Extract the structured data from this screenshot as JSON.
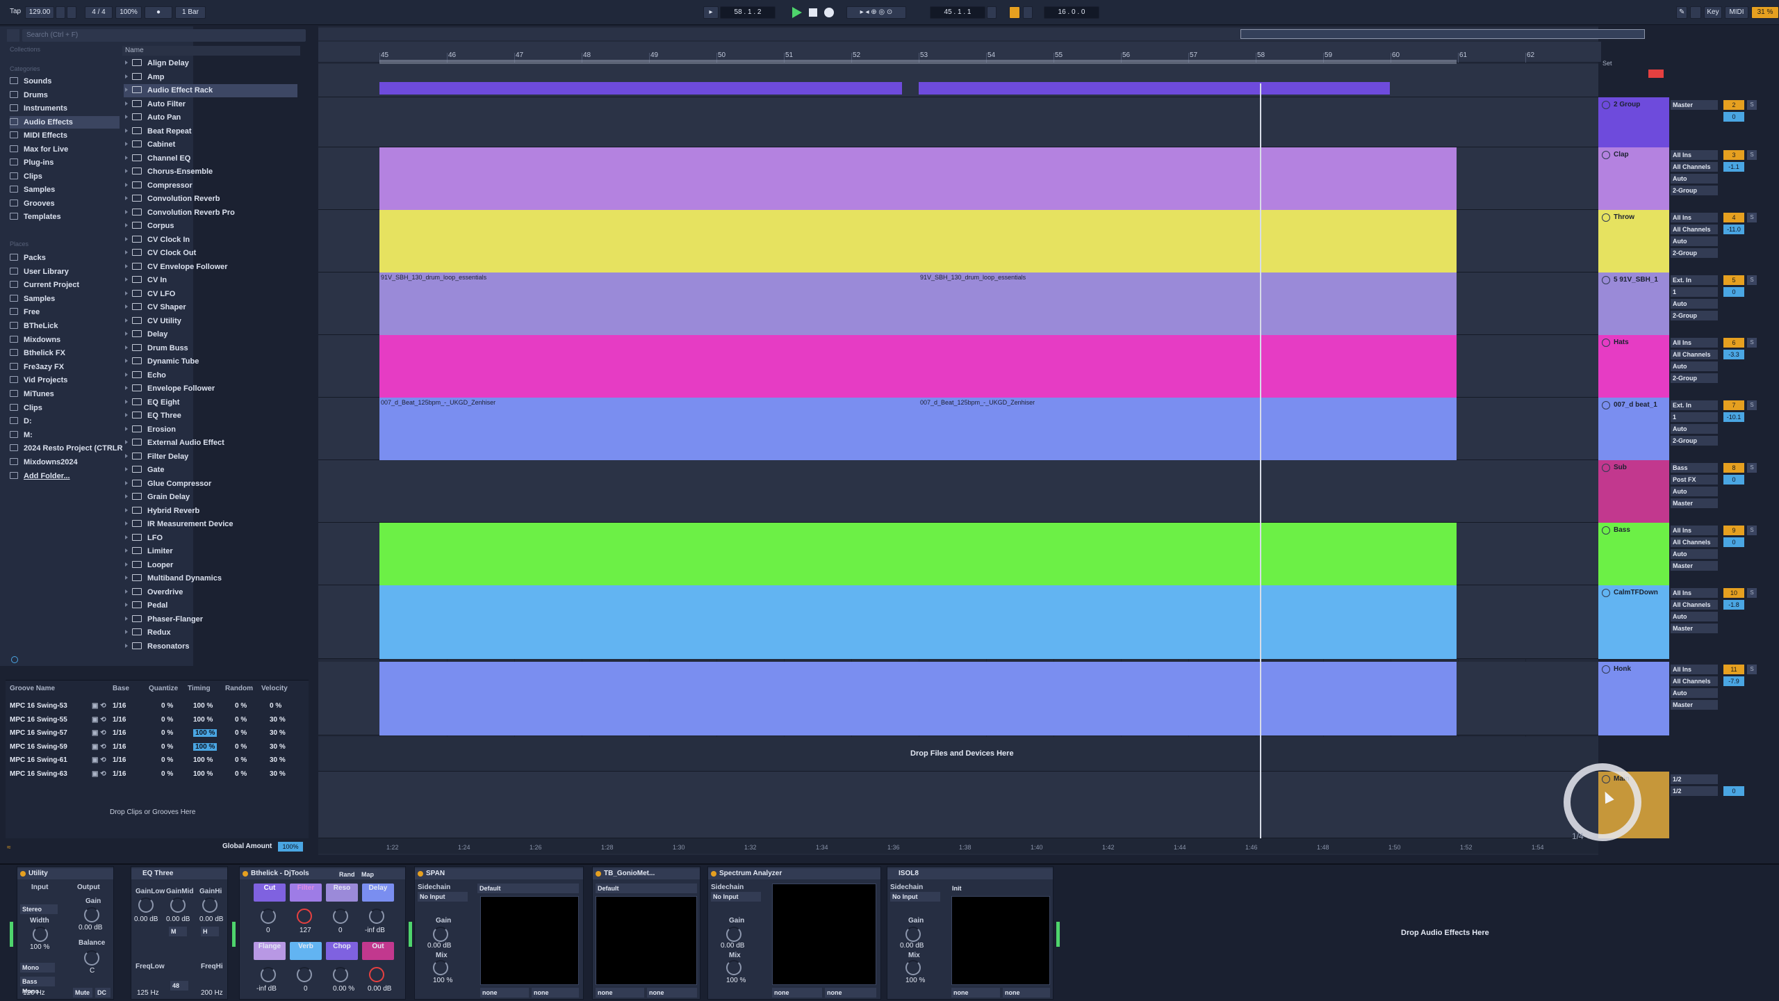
{
  "colors": {
    "accent": "#e6a020",
    "selection": "#4aa6e3",
    "play": "#4ed46c",
    "background": "#1b2131"
  },
  "transport": {
    "tap": "Tap",
    "tempo": "129.00",
    "time_sig": "4 / 4",
    "zoom": "100%",
    "quantize": "1 Bar",
    "position": "58 . 1 . 2",
    "loop_start": "45 . 1 . 1",
    "loop_length": "16 . 0 . 0",
    "key_label": "Key",
    "midi_label": "MIDI",
    "cpu": "31 %"
  },
  "browser": {
    "search_placeholder": "Search (Ctrl + F)",
    "collections_header": "Collections",
    "categories_header": "Categories",
    "places_header": "Places",
    "categories": [
      "Sounds",
      "Drums",
      "Instruments",
      "Audio Effects",
      "MIDI Effects",
      "Max for Live",
      "Plug-ins",
      "Clips",
      "Samples",
      "Grooves",
      "Templates"
    ],
    "places": [
      "Packs",
      "User Library",
      "Current Project",
      "Samples",
      "Free",
      "BTheLick",
      "Mixdowns",
      "Bthelick FX",
      "Fre3azy FX",
      "Vid Projects",
      "MiTunes",
      "Clips",
      "D:",
      "M:",
      "2024 Resto Project (CTRLR",
      "Mixdowns2024",
      "Add Folder..."
    ],
    "name_header": "Name",
    "items": [
      "Align Delay",
      "Amp",
      "Audio Effect Rack",
      "Auto Filter",
      "Auto Pan",
      "Beat Repeat",
      "Cabinet",
      "Channel EQ",
      "Chorus-Ensemble",
      "Compressor",
      "Convolution Reverb",
      "Convolution Reverb Pro",
      "Corpus",
      "CV Clock In",
      "CV Clock Out",
      "CV Envelope Follower",
      "CV In",
      "CV LFO",
      "CV Shaper",
      "CV Utility",
      "Delay",
      "Drum Buss",
      "Dynamic Tube",
      "Echo",
      "Envelope Follower",
      "EQ Eight",
      "EQ Three",
      "Erosion",
      "External Audio Effect",
      "Filter Delay",
      "Gate",
      "Glue Compressor",
      "Grain Delay",
      "Hybrid Reverb",
      "IR Measurement Device",
      "LFO",
      "Limiter",
      "Looper",
      "Multiband Dynamics",
      "Overdrive",
      "Pedal",
      "Phaser-Flanger",
      "Redux",
      "Resonators"
    ]
  },
  "groove_pool": {
    "headers": [
      "Groove Name",
      "Base",
      "Quantize",
      "Timing",
      "Random",
      "Velocity"
    ],
    "rows": [
      {
        "name": "MPC 16 Swing-53",
        "base": "1/16",
        "quantize": "0 %",
        "timing": "100 %",
        "random": "0 %",
        "velocity": "0 %"
      },
      {
        "name": "MPC 16 Swing-55",
        "base": "1/16",
        "quantize": "0 %",
        "timing": "100 %",
        "random": "0 %",
        "velocity": "30 %"
      },
      {
        "name": "MPC 16 Swing-57",
        "base": "1/16",
        "quantize": "0 %",
        "timing": "100 %",
        "random": "0 %",
        "velocity": "30 %"
      },
      {
        "name": "MPC 16 Swing-59",
        "base": "1/16",
        "quantize": "0 %",
        "timing": "100 %",
        "random": "0 %",
        "velocity": "30 %"
      },
      {
        "name": "MPC 16 Swing-61",
        "base": "1/16",
        "quantize": "0 %",
        "timing": "100 %",
        "random": "0 %",
        "velocity": "30 %"
      },
      {
        "name": "MPC 16 Swing-63",
        "base": "1/16",
        "quantize": "0 %",
        "timing": "100 %",
        "random": "0 %",
        "velocity": "30 %"
      }
    ],
    "drop_hint": "Drop Clips or Grooves Here",
    "global_amount_label": "Global Amount",
    "global_amount": "100%"
  },
  "ruler": {
    "bars": [
      "45",
      "46",
      "47",
      "48",
      "49",
      "50",
      "51",
      "52",
      "53",
      "54",
      "55",
      "56",
      "57",
      "58",
      "59",
      "60",
      "61",
      "62"
    ],
    "times": [
      "1:22",
      "1:24",
      "1:26",
      "1:28",
      "1:30",
      "1:32",
      "1:34",
      "1:36",
      "1:38",
      "1:40",
      "1:42",
      "1:44",
      "1:46",
      "1:48",
      "1:50",
      "1:52",
      "1:54"
    ],
    "set_label": "Set"
  },
  "tracks": [
    {
      "name": "2 Group",
      "color": "#6e4bdc",
      "routing": [
        "Master"
      ],
      "number": "2",
      "volume": "0"
    },
    {
      "name": "Clap",
      "color": "#b482e0",
      "routing": [
        "All Ins",
        "All Channels",
        "Auto",
        "2-Group"
      ],
      "number": "3",
      "volume": "-1.1"
    },
    {
      "name": "Throw",
      "color": "#e6e260",
      "routing": [
        "All Ins",
        "All Channels",
        "Auto",
        "2-Group"
      ],
      "number": "4",
      "volume": "-11.0"
    },
    {
      "name": "5 91V_SBH_1",
      "color": "#9a8ad8",
      "routing": [
        "Ext. In",
        "1",
        "Auto",
        "2-Group"
      ],
      "number": "5",
      "volume": "0"
    },
    {
      "name": "Hats",
      "color": "#e63cc4",
      "routing": [
        "All Ins",
        "All Channels",
        "Auto",
        "2-Group"
      ],
      "number": "6",
      "volume": "-3.3"
    },
    {
      "name": "007_d beat_1",
      "color": "#7a8ef0",
      "routing": [
        "Ext. In",
        "1",
        "Auto",
        "2-Group"
      ],
      "number": "7",
      "volume": "-10.1"
    },
    {
      "name": "Sub",
      "color": "#c2388e",
      "routing": [
        "Bass",
        "Post FX",
        "Auto",
        "Master"
      ],
      "number": "8",
      "volume": "0"
    },
    {
      "name": "Bass",
      "color": "#6cf046",
      "routing": [
        "All Ins",
        "All Channels",
        "Auto",
        "Master"
      ],
      "number": "9",
      "volume": "0"
    },
    {
      "name": "CalmTFDown",
      "color": "#62b4f2",
      "routing": [
        "All Ins",
        "All Channels",
        "Auto",
        "Master"
      ],
      "number": "10",
      "volume": "-1.8"
    },
    {
      "name": "Honk",
      "color": "#7a8ef0",
      "routing": [
        "All Ins",
        "All Channels",
        "Auto",
        "Master"
      ],
      "number": "11",
      "volume": "-7.9"
    },
    {
      "name": "Main",
      "color": "#c6973a",
      "routing": [
        "1/2",
        "1/2"
      ],
      "number": "",
      "volume": "0"
    }
  ],
  "clips": {
    "drum_loop_a": "91V_SBH_130_drum_loop_essentials",
    "drum_loop_b": "91V_SBH_130_drum_loop_essentials",
    "beat_a": "007_d_Beat_125bpm_-_UKGD_Zenhiser",
    "beat_b": "007_d_Beat_125bpm_-_UKGD_Zenhiser"
  },
  "drop_files_hint": "Drop Files and Devices Here",
  "scroll_indicator": "1/4",
  "devices": {
    "utility": {
      "title": "Utility",
      "input": "Input",
      "output": "Output",
      "mode": "Stereo",
      "width_label": "Width",
      "width": "100 %",
      "gain_label": "Gain",
      "gain": "0.00 dB",
      "balance_label": "Balance",
      "balance": "C",
      "mono": "Mono",
      "bass_mono": "Bass Mono",
      "bass_freq": "120 Hz",
      "mute": "Mute",
      "dc": "DC"
    },
    "eq3": {
      "title": "EQ Three",
      "gainlow_label": "GainLow",
      "gainmid_label": "GainMid",
      "gainhi_label": "GainHi",
      "gainlow": "0.00 dB",
      "gainmid": "0.00 dB",
      "gainhi": "0.00 dB",
      "m": "M",
      "h": "H",
      "freqlow_label": "FreqLow",
      "freqhi_label": "FreqHi",
      "freqlow": "125 Hz",
      "freqhi": "200 Hz",
      "mid_val": "48"
    },
    "djtools": {
      "title": "Bthelick - DjTools",
      "rand": "Rand",
      "map": "Map",
      "pads_top": [
        "Cut",
        "Filter",
        "Reso",
        "Delay"
      ],
      "pads_bottom": [
        "Flange",
        "Verb",
        "Chop",
        "Out"
      ],
      "vals_top": [
        "0",
        "127",
        "0",
        "-inf dB"
      ],
      "vals_bottom": [
        "-inf dB",
        "0",
        "0.00 %",
        "0.00 dB"
      ]
    },
    "span": {
      "title": "SPAN",
      "sidechain": "Sidechain",
      "input": "No Input",
      "preset": "Default",
      "gain_label": "Gain",
      "gain": "0.00 dB",
      "mix_label": "Mix",
      "mix": "100 %",
      "out1": "none",
      "out2": "none"
    },
    "goniometer": {
      "title": "TB_GonioMet...",
      "preset": "Default",
      "out1": "none",
      "out2": "none"
    },
    "spectrum": {
      "title": "Spectrum Analyzer",
      "sidechain": "Sidechain",
      "input": "No Input",
      "gain_label": "Gain",
      "gain": "0.00 dB",
      "mix_label": "Mix",
      "mix": "100 %",
      "out1": "none",
      "out2": "none"
    },
    "isol8": {
      "title": "ISOL8",
      "sidechain": "Sidechain",
      "input": "No Input",
      "preset": "Init",
      "gain_label": "Gain",
      "gain": "0.00 dB",
      "mix_label": "Mix",
      "mix": "100 %",
      "out1": "none",
      "out2": "none"
    },
    "drop_hint": "Drop Audio Effects Here"
  }
}
